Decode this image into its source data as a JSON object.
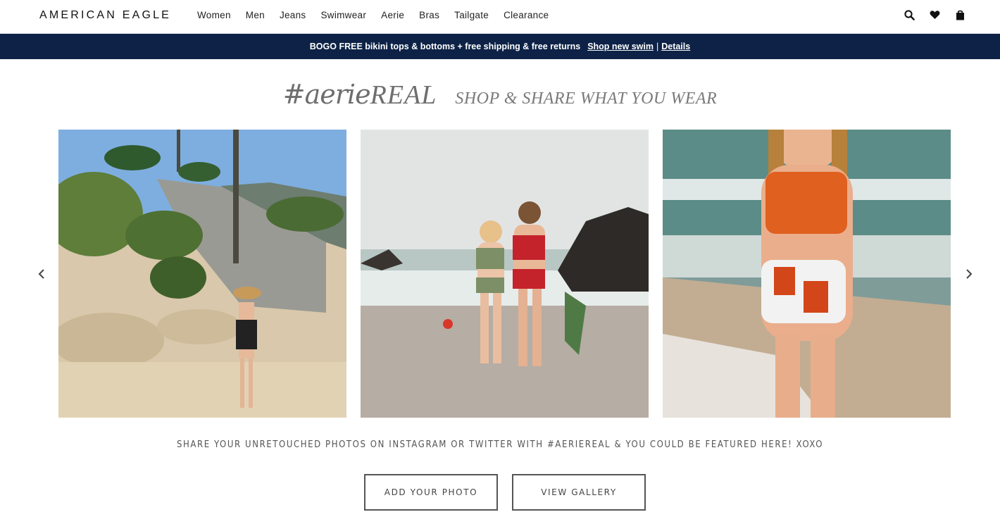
{
  "header": {
    "logo": "AMERICAN EAGLE",
    "nav": [
      "Women",
      "Men",
      "Jeans",
      "Swimwear",
      "Aerie",
      "Bras",
      "Tailgate",
      "Clearance"
    ],
    "icons": [
      "search-icon",
      "heart-icon",
      "bag-icon"
    ]
  },
  "promo": {
    "text": "BOGO FREE bikini tops & bottoms + free shipping & free returns",
    "shop_link": "Shop new swim",
    "separator": "|",
    "details_link": "Details"
  },
  "section": {
    "hashtag": "#aerie",
    "real": "REAL",
    "tagline": "SHOP & SHARE WHAT YOU WEAR",
    "caption": "SHARE YOUR UNRETOUCHED PHOTOS ON INSTAGRAM OR TWITTER WITH #AERIEREAL & YOU COULD BE FEATURED HERE! XOXO",
    "add_photo_label": "ADD YOUR PHOTO",
    "view_gallery_label": "VIEW GALLERY"
  },
  "carousel": {
    "prev_icon": "chevron-left-icon",
    "next_icon": "chevron-right-icon",
    "photos": [
      "beach-cliff-photo",
      "two-women-beach-photo",
      "orange-bikini-photo"
    ]
  },
  "colors": {
    "promo_bg": "#0d2246",
    "text_gray": "#6e6e6e"
  }
}
